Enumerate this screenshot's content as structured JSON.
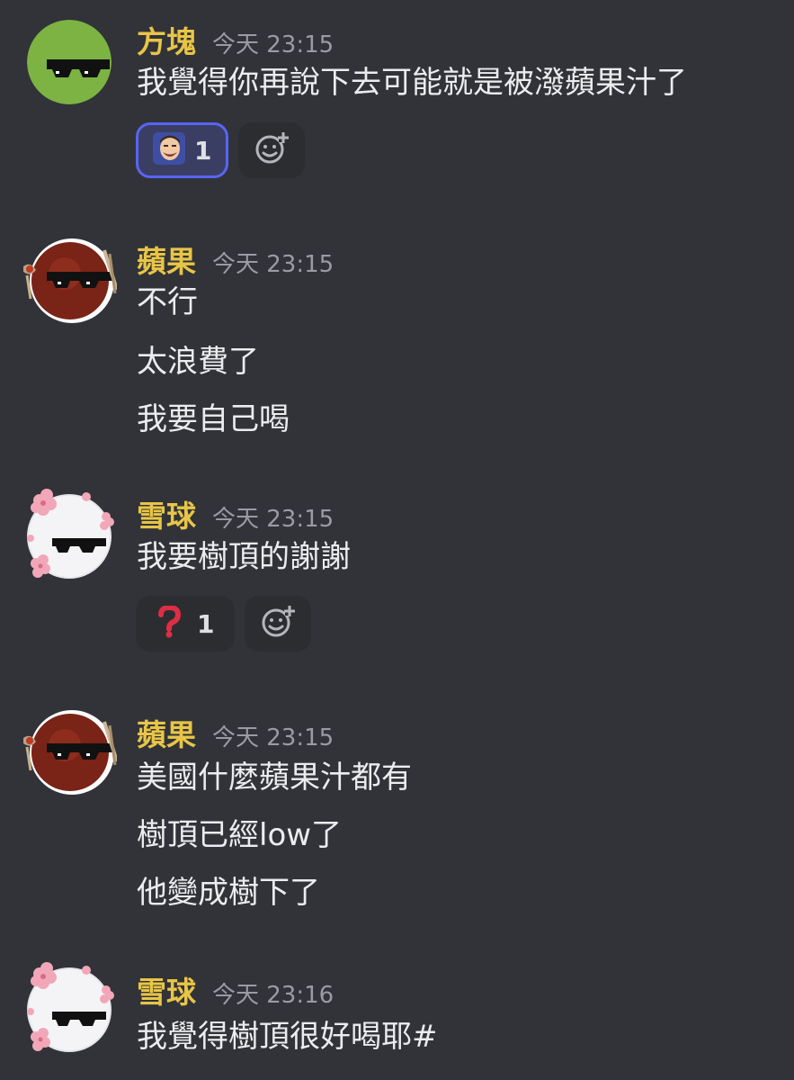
{
  "messages": [
    {
      "username": "方塊",
      "time": "今天 23:15",
      "lines": [
        "我覺得你再說下去可能就是被潑蘋果汁了"
      ],
      "reaction": {
        "emoji": "laughing-man-emoji",
        "count": "1",
        "active": true
      }
    },
    {
      "username": "蘋果",
      "time": "今天 23:15",
      "lines": [
        "不行",
        "太浪費了",
        "我要自己喝"
      ]
    },
    {
      "username": "雪球",
      "time": "今天 23:15",
      "lines": [
        "我要樹頂的謝謝"
      ],
      "reaction": {
        "emoji": "red-question-mark-emoji",
        "count": "1",
        "active": false
      }
    },
    {
      "username": "蘋果",
      "time": "今天 23:15",
      "lines": [
        "美國什麼蘋果汁都有",
        "樹頂已經low了",
        "他變成樹下了"
      ]
    },
    {
      "username": "雪球",
      "time": "今天 23:16",
      "lines": [
        "我覺得樹頂很好喝耶#"
      ]
    }
  ],
  "colors": {
    "background": "#313338",
    "username": "#e8c547",
    "timestamp": "#9a9ba3",
    "reaction_active_border": "#5865f2"
  }
}
